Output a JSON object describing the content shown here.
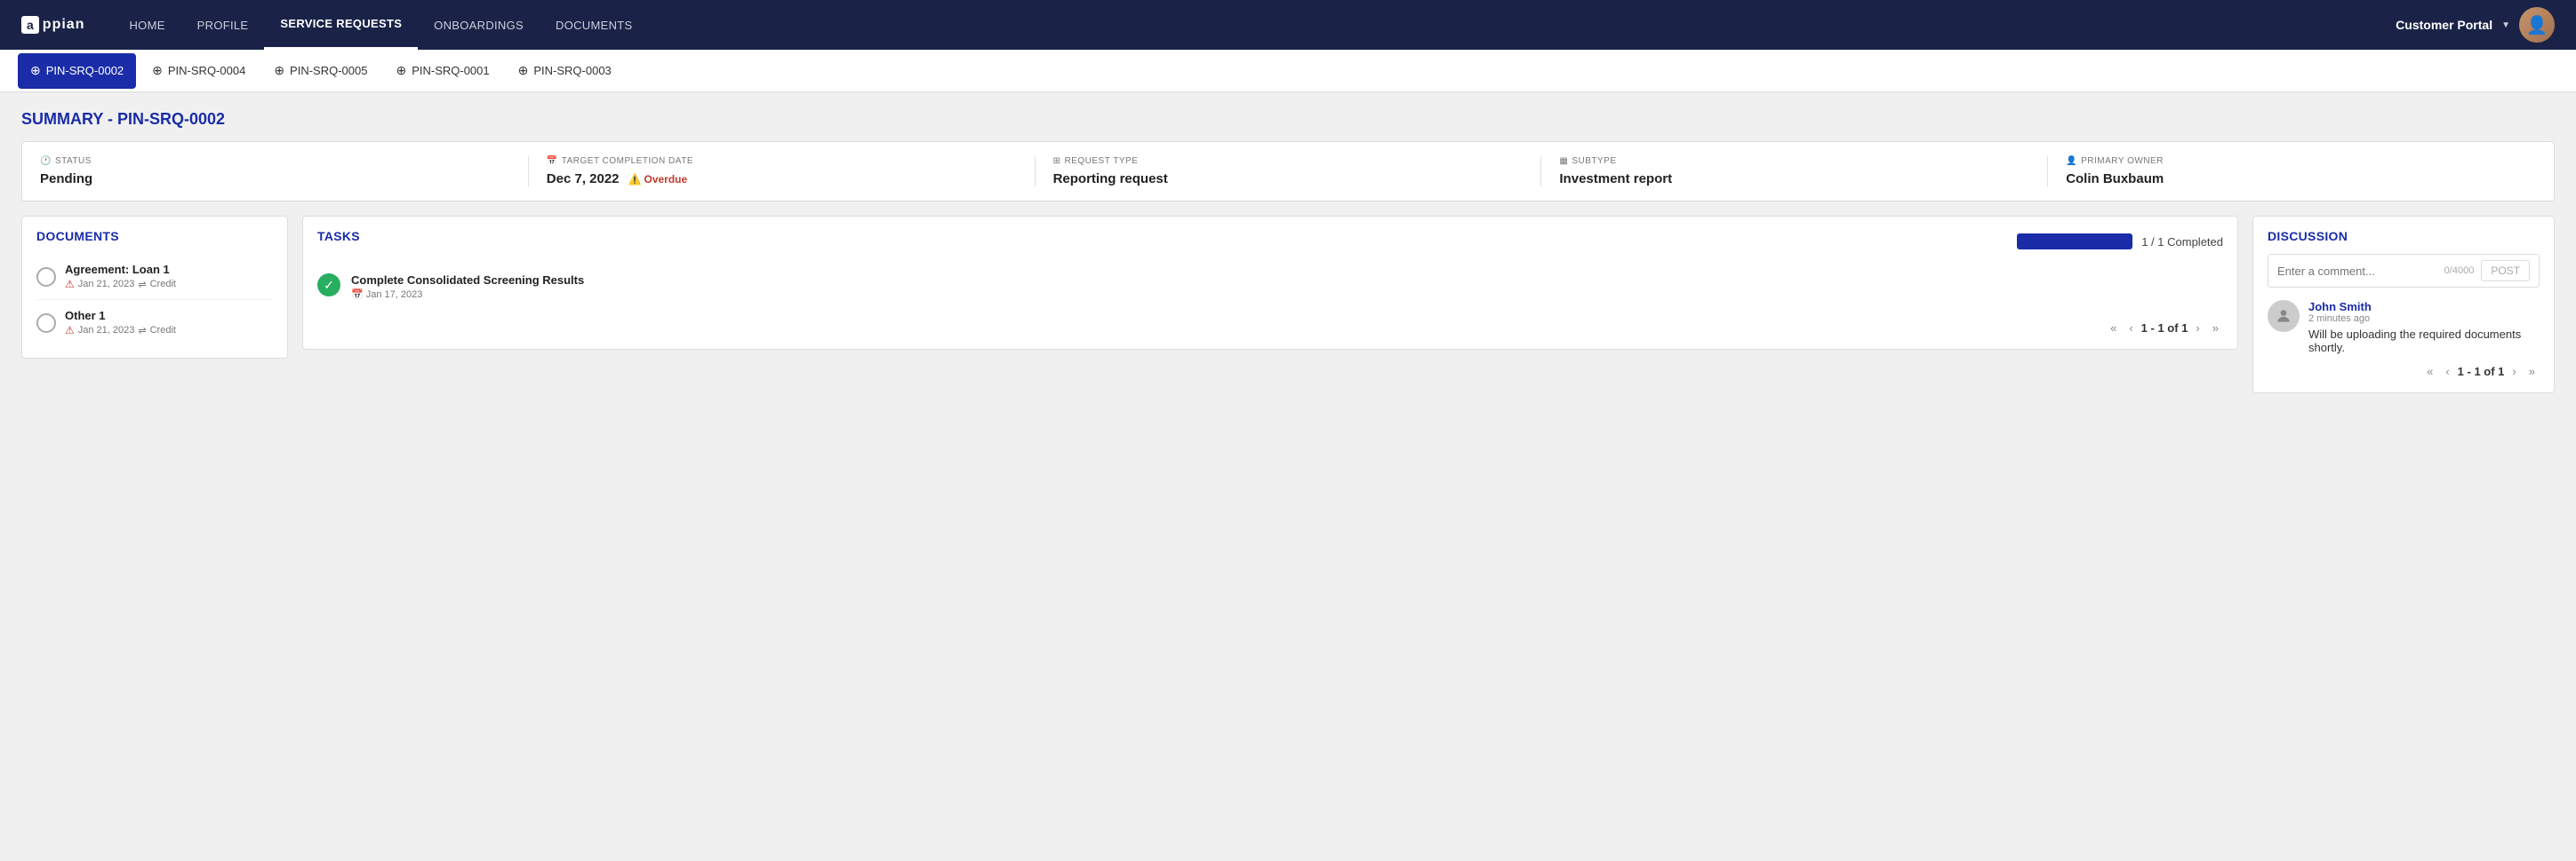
{
  "navbar": {
    "logo": "appian",
    "links": [
      {
        "label": "HOME",
        "active": false
      },
      {
        "label": "PROFILE",
        "active": false
      },
      {
        "label": "SERVICE REQUESTS",
        "active": true
      },
      {
        "label": "ONBOARDINGS",
        "active": false
      },
      {
        "label": "DOCUMENTS",
        "active": false
      }
    ],
    "portal_label": "Customer Portal",
    "portal_caret": "▼"
  },
  "tabs": [
    {
      "id": "PIN-SRQ-0002",
      "active": true
    },
    {
      "id": "PIN-SRQ-0004",
      "active": false
    },
    {
      "id": "PIN-SRQ-0005",
      "active": false
    },
    {
      "id": "PIN-SRQ-0001",
      "active": false
    },
    {
      "id": "PIN-SRQ-0003",
      "active": false
    }
  ],
  "summary": {
    "title": "SUMMARY - PIN-SRQ-0002",
    "status_label": "STATUS",
    "status_value": "Pending",
    "target_date_label": "TARGET COMPLETION DATE",
    "target_date_value": "Dec 7, 2022",
    "overdue_label": "Overdue",
    "request_type_label": "REQUEST TYPE",
    "request_type_value": "Reporting request",
    "subtype_label": "SUBTYPE",
    "subtype_value": "Investment report",
    "primary_owner_label": "PRIMARY OWNER",
    "primary_owner_value": "Colin Buxbaum"
  },
  "documents": {
    "title": "DOCUMENTS",
    "items": [
      {
        "name": "Agreement: Loan 1",
        "date": "Jan 21, 2023",
        "tag": "Credit"
      },
      {
        "name": "Other 1",
        "date": "Jan 21, 2023",
        "tag": "Credit"
      }
    ]
  },
  "tasks": {
    "title": "TASKS",
    "progress_label": "1 / 1 Completed",
    "items": [
      {
        "name": "Complete Consolidated Screening Results",
        "date": "Jan 17, 2023",
        "completed": true
      }
    ],
    "pagination": "1 - 1 of 1"
  },
  "discussion": {
    "title": "DISCUSSION",
    "comment_placeholder": "Enter a comment...",
    "comment_counter": "0/4000",
    "post_label": "POST",
    "comments": [
      {
        "author": "John Smith",
        "time": "2 minutes ago",
        "text": "Will be uploading the required documents shortly."
      }
    ],
    "pagination": "1 - 1 of 1"
  }
}
